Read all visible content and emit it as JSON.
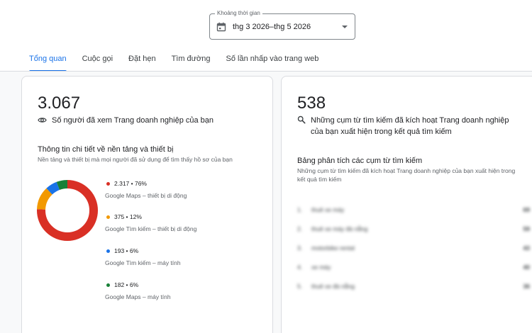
{
  "date_range": {
    "legend": "Khoảng thời gian",
    "value": "thg 3 2026–thg 5 2026"
  },
  "tabs": [
    {
      "label": "Tổng quan",
      "active": true
    },
    {
      "label": "Cuộc gọi",
      "active": false
    },
    {
      "label": "Đặt hẹn",
      "active": false
    },
    {
      "label": "Tìm đường",
      "active": false
    },
    {
      "label": "Số lần nhấp vào trang web",
      "active": false
    }
  ],
  "left_card": {
    "total": "3.067",
    "total_label": "Số người đã xem Trang doanh nghiệp của bạn",
    "icon": "eye-icon",
    "breakdown_title": "Thông tin chi tiết về nền tảng và thiết bị",
    "breakdown_subtitle": "Nền tảng và thiết bị mà mọi người đã sử dụng để tìm thấy hồ sơ của bạn",
    "chart_data": {
      "type": "pie",
      "categories": [
        "Google Maps – thiết bị di động",
        "Google Tìm kiếm – thiết bị di động",
        "Google Tìm kiếm – máy tính",
        "Google Maps – máy tính"
      ],
      "values": [
        2317,
        375,
        193,
        182
      ],
      "percents": [
        76,
        12,
        6,
        6
      ],
      "colors": [
        "#d93025",
        "#f29900",
        "#1a73e8",
        "#188038"
      ],
      "donut": true
    },
    "legend": [
      {
        "value": "2.317 • 76%",
        "name": "Google Maps – thiết bị di động",
        "color": "#d93025"
      },
      {
        "value": "375 • 12%",
        "name": "Google Tìm kiếm – thiết bị di động",
        "color": "#f29900"
      },
      {
        "value": "193 • 6%",
        "name": "Google Tìm kiếm – máy tính",
        "color": "#1a73e8"
      },
      {
        "value": "182 • 6%",
        "name": "Google Maps – máy tính",
        "color": "#188038"
      }
    ]
  },
  "right_card": {
    "total": "538",
    "total_label": "Những cụm từ tìm kiếm đã kích hoạt Trang doanh nghiệp của bạn xuất hiện trong kết quả tìm kiếm",
    "icon": "search-icon",
    "breakdown_title": "Bảng phân tích các cụm từ tìm kiếm",
    "breakdown_subtitle": "Những cụm từ tìm kiếm đã kích hoạt Trang doanh nghiệp của bạn xuất hiện trong kết quả tìm kiếm",
    "terms": [
      {
        "index": "1.",
        "term": "thuê xe máy",
        "count": "69"
      },
      {
        "index": "2.",
        "term": "thuê xe máy đà nẵng",
        "count": "59"
      },
      {
        "index": "3.",
        "term": "motorbike rental",
        "count": "43"
      },
      {
        "index": "4.",
        "term": "xe máy",
        "count": "40"
      },
      {
        "index": "5.",
        "term": "thuê xe đà nẵng",
        "count": "36"
      }
    ]
  }
}
